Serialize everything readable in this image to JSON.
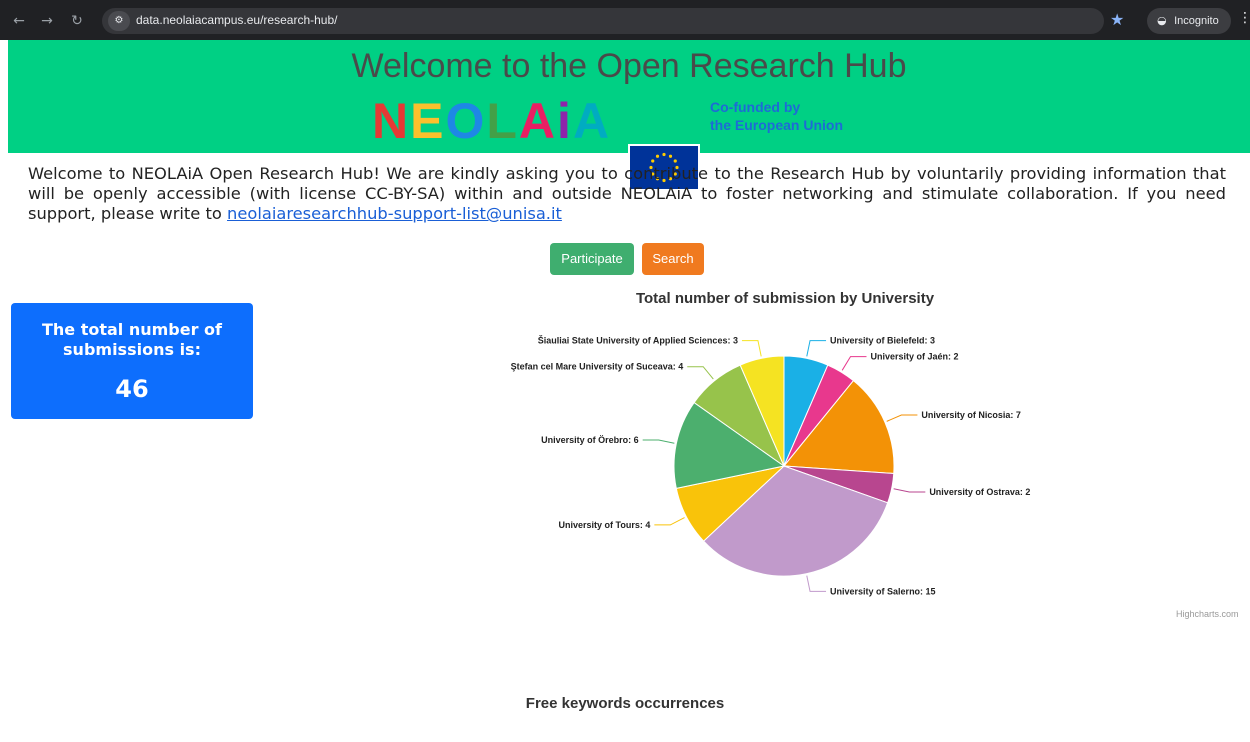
{
  "browser": {
    "url": "data.neolaiacampus.eu/research-hub/",
    "incognito_label": "Incognito"
  },
  "header": {
    "title": "Welcome to the Open Research Hub",
    "logo_text": "NEOLAiA",
    "eu_line1": "Co-funded by",
    "eu_line2": "the European Union"
  },
  "intro": {
    "text": "Welcome to NEOLAiA Open Research Hub! We are kindly asking you to contribute to the Research Hub by voluntarily providing information that will be openly accessible (with license CC-BY-SA) within and outside NEOLAiA to foster networking and stimulate collaboration. If you need support, please write to ",
    "email": "neolaiaresearchhub-support-list@unisa.it"
  },
  "buttons": {
    "participate": "Participate",
    "search": "Search"
  },
  "total_box": {
    "label": "The total number of submissions is:",
    "value": "46"
  },
  "chart_data": {
    "type": "pie",
    "title": "Total number of submission by University",
    "slices": [
      {
        "name": "University of Bielefeld",
        "value": 3,
        "color": "#1ab0e6"
      },
      {
        "name": "University of Jaén",
        "value": 2,
        "color": "#e8388d"
      },
      {
        "name": "University of Nicosia",
        "value": 7,
        "color": "#f39206"
      },
      {
        "name": "University of Ostrava",
        "value": 2,
        "color": "#b8468f"
      },
      {
        "name": "University of Salerno",
        "value": 15,
        "color": "#c19acb"
      },
      {
        "name": "University of Tours",
        "value": 4,
        "color": "#f9c30a"
      },
      {
        "name": "University of Örebro",
        "value": 6,
        "color": "#4caf6e"
      },
      {
        "name": "Ştefan cel Mare University of Suceava",
        "value": 4,
        "color": "#97c34b"
      },
      {
        "name": "Šiauliai State University of Applied Sciences",
        "value": 3,
        "color": "#f5e322"
      }
    ],
    "credits": "Highcharts.com"
  },
  "keywords_title": "Free keywords occurrences"
}
